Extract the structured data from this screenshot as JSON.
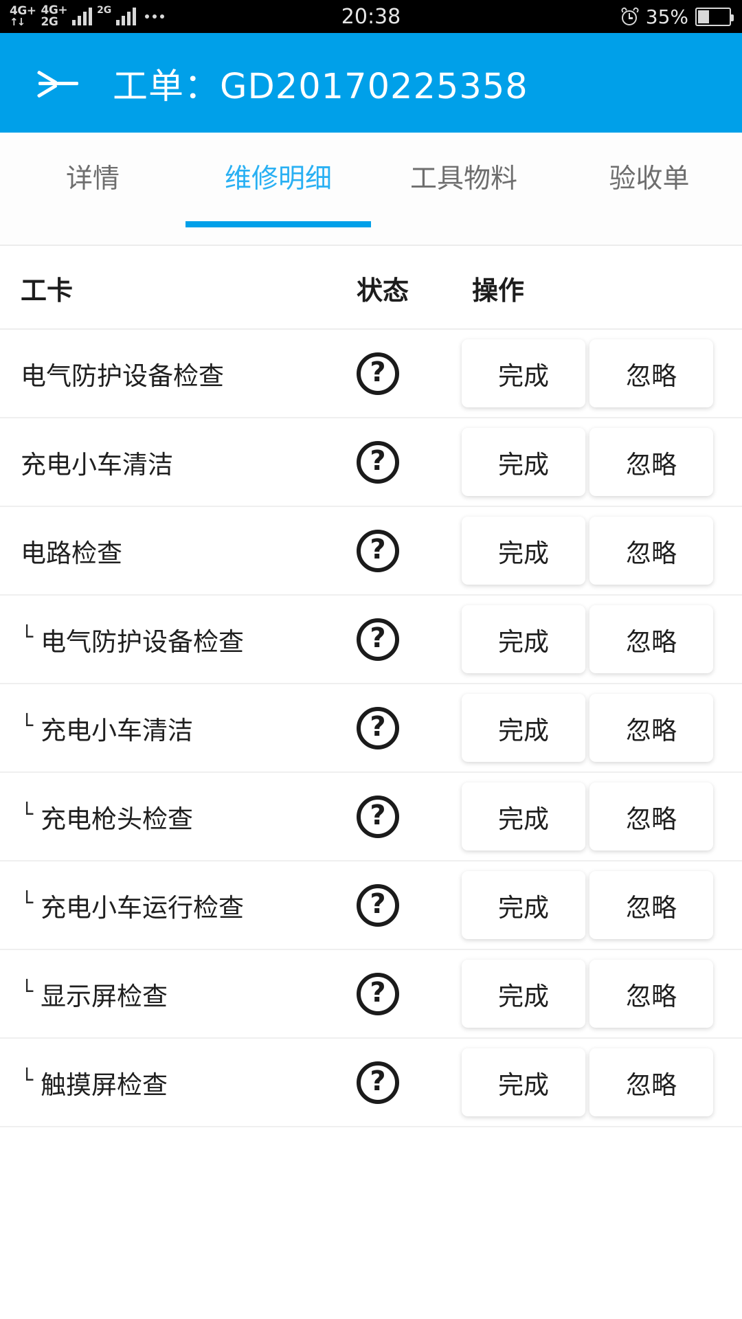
{
  "status_bar": {
    "sim1_network": "4G+",
    "sim1_arrows": "↑↓",
    "sim2_network_top": "4G+",
    "sim2_network_bottom": "2G",
    "sim3_network": "2G",
    "overflow": "more-icon",
    "time": "20:38",
    "alarm": "alarm-icon",
    "battery_percent": "35%",
    "battery_level": 35
  },
  "app_bar": {
    "back": "back-arrow-icon",
    "title": "工单：GD20170225358"
  },
  "tabs": {
    "items": [
      {
        "label": "详情",
        "active": false
      },
      {
        "label": "维修明细",
        "active": true
      },
      {
        "label": "工具物料",
        "active": false
      },
      {
        "label": "验收单",
        "active": false
      }
    ],
    "active_index": 1,
    "active_color": "#29b0f3",
    "indicator_color": "#00a0e9"
  },
  "table": {
    "headers": {
      "work_card": "工卡",
      "status": "状态",
      "action": "操作"
    },
    "status_icon": "question-mark-icon",
    "status_glyph": "?",
    "buttons": {
      "complete": "完成",
      "ignore": "忽略"
    },
    "rows": [
      {
        "name": "电气防护设备检查",
        "indent": false,
        "status": "?"
      },
      {
        "name": "充电小车清洁",
        "indent": false,
        "status": "?"
      },
      {
        "name": "电路检查",
        "indent": false,
        "status": "?"
      },
      {
        "name": "电气防护设备检查",
        "indent": true,
        "status": "?"
      },
      {
        "name": "充电小车清洁",
        "indent": true,
        "status": "?"
      },
      {
        "name": "充电枪头检查",
        "indent": true,
        "status": "?"
      },
      {
        "name": "充电小车运行检查",
        "indent": true,
        "status": "?"
      },
      {
        "name": "显示屏检查",
        "indent": true,
        "status": "?"
      },
      {
        "name": "触摸屏检查",
        "indent": true,
        "status": "?"
      }
    ],
    "tree_marker": "└"
  },
  "theme": {
    "accent": "#00a0e9",
    "page_bg": "#ffffff",
    "row_bg": "#ffffff",
    "divider": "#efefef"
  }
}
